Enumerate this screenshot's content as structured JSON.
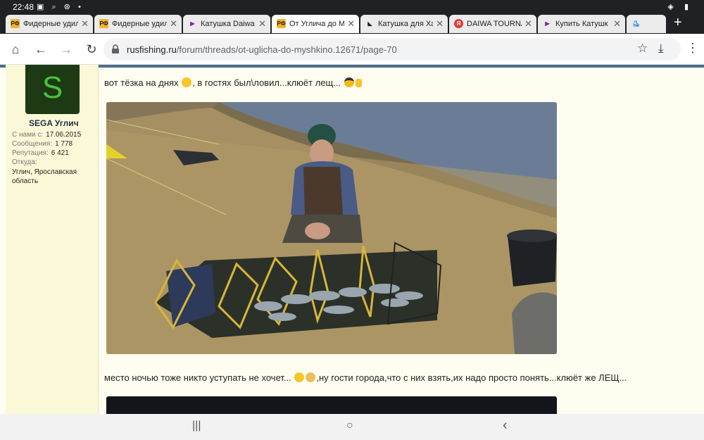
{
  "status": {
    "time": "22:48",
    "icons": "▣ ⌕ ⊛ •",
    "right": "◈ ▮"
  },
  "tabs": [
    {
      "favicon": "РФ",
      "favicon_color": "#f2b52b",
      "label": "Фидерные удил"
    },
    {
      "favicon": "РФ",
      "favicon_color": "#f2b52b",
      "label": "Фидерные удил"
    },
    {
      "favicon": "▶",
      "favicon_color": "#7b1fa2",
      "label": "Катушка Daiwa"
    },
    {
      "favicon": "РФ",
      "favicon_color": "#f2b52b",
      "label": "От Углича до М"
    },
    {
      "favicon": "◣",
      "favicon_color": "#222222",
      "label": "Катушка для Ха"
    },
    {
      "favicon": "Я",
      "favicon_color": "#e53935",
      "label": "DAIWA TOURNA"
    },
    {
      "favicon": "▶",
      "favicon_color": "#7b1fa2",
      "label": "Купить Катушк"
    }
  ],
  "toolbar": {
    "home": "⌂",
    "back": "←",
    "forward": "→",
    "reload": "↻",
    "lock": "🔒",
    "url_host": "rusfishing.ru",
    "url_path": "/forum/threads/ot-uglicha-do-myshkino.12671/page-70",
    "star": "☆",
    "download": "⤓",
    "menu": "⋮"
  },
  "user": {
    "avatar_letter": "S",
    "name": "SEGA Углич",
    "joined_label": "С нами с:",
    "joined_value": "17.06.2015",
    "messages_label": "Сообщения:",
    "messages_value": "1 778",
    "reputation_label": "Репутация:",
    "reputation_value": "6 421",
    "from_label": "Откуда:",
    "from_value": "Углич, Ярославская область"
  },
  "post": {
    "line1_a": "вот тёзка на днях",
    "line1_b": ", в гостях был\\ловил...клюёт лещ...",
    "line2_a": "место ночью тоже никто уступать не хочет...",
    "line2_b": ",ну гости города,что с них взять,их надо просто понять...клюёт же ЛЕЩ..."
  },
  "navbar": {
    "recent": "|||",
    "home": "○",
    "back": "‹"
  },
  "colors": {
    "accent": "#4d6f8a",
    "page_bg": "#fffdf0",
    "sidebar_bg": "#fbf8d8",
    "avatar_bg": "#1d3a14",
    "avatar_fg": "#48c23a"
  }
}
